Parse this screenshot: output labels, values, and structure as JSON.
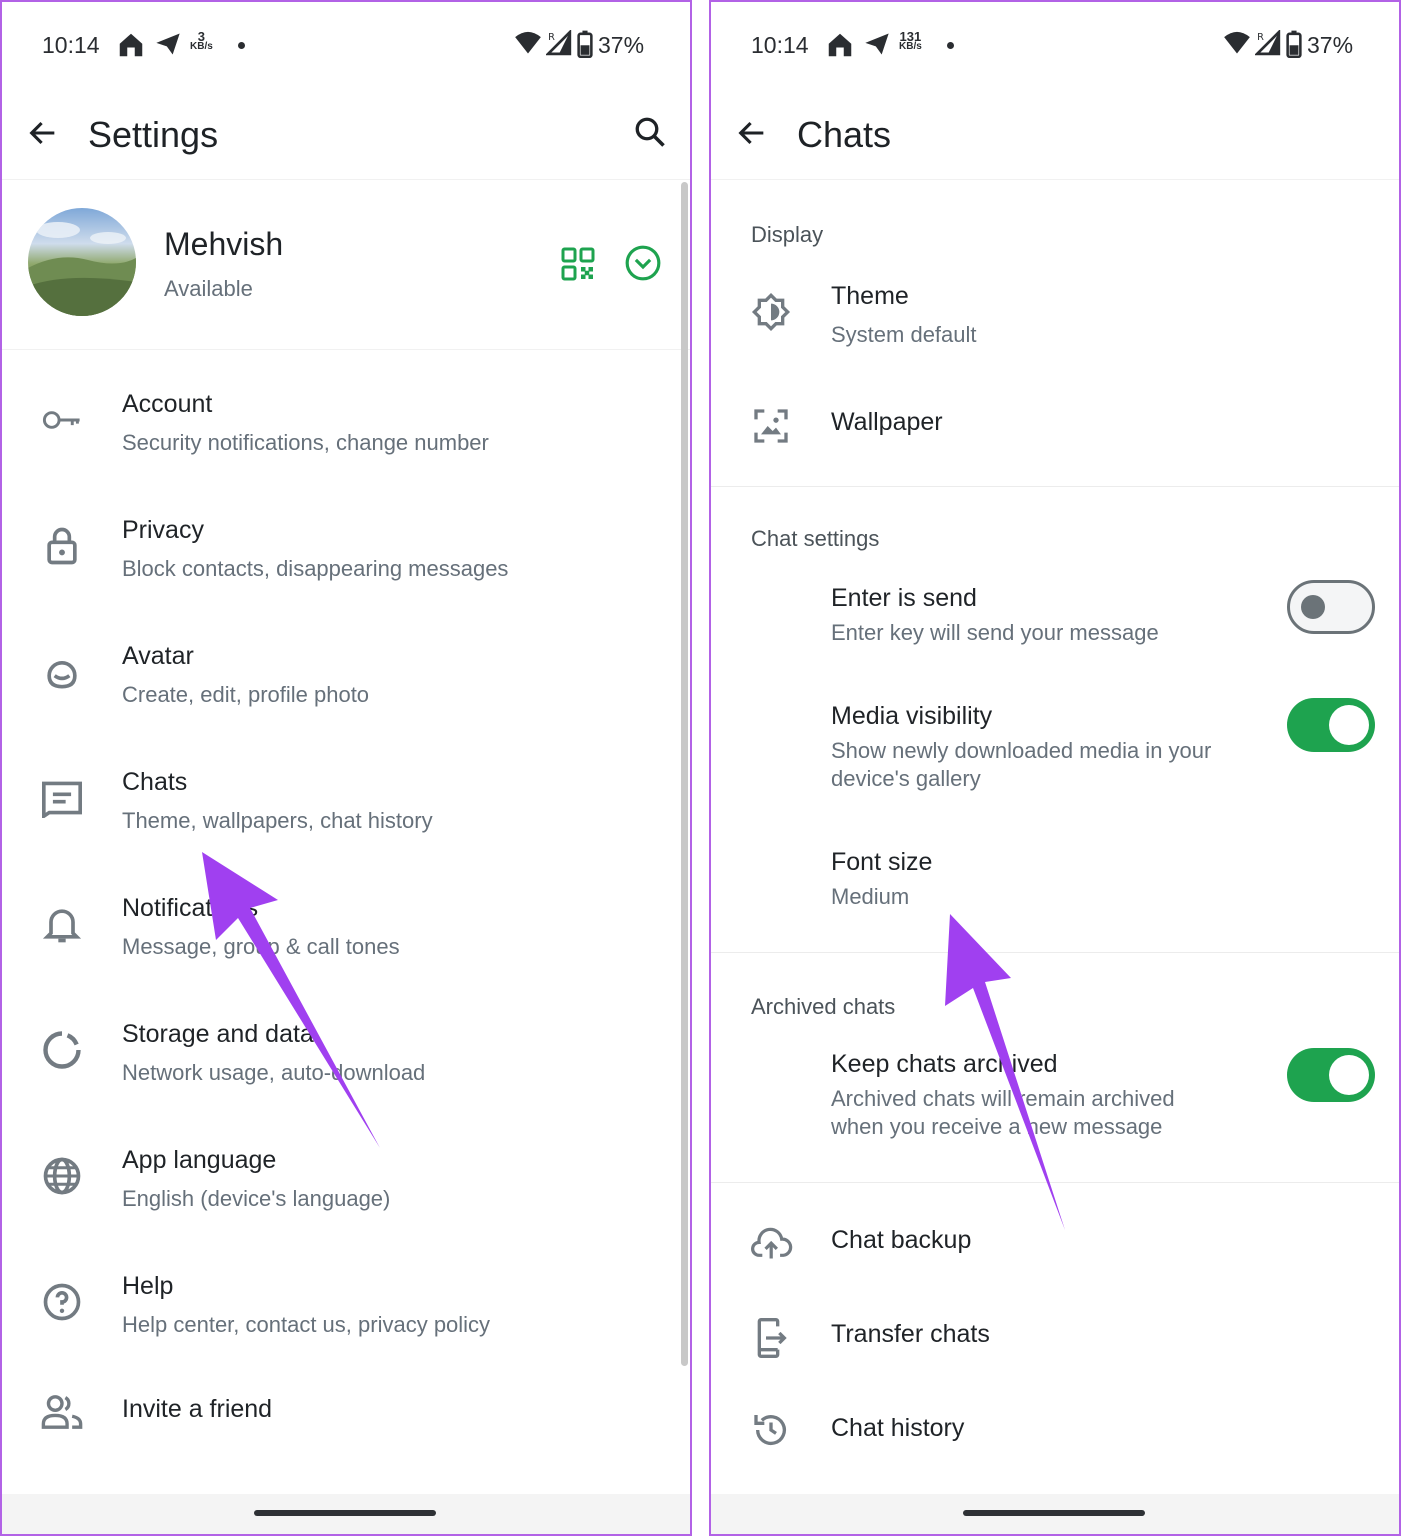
{
  "colors": {
    "accent": "#1ea34f",
    "arrow": "#a040f0",
    "border": "#b262e6"
  },
  "left": {
    "status": {
      "time": "10:14",
      "speed_value": "3",
      "speed_unit": "KB/s",
      "battery": "37%"
    },
    "appbar": {
      "title": "Settings",
      "back_icon": "arrow-back-icon",
      "search_icon": "search-icon"
    },
    "profile": {
      "name": "Mehvish",
      "status": "Available",
      "qr_icon": "qr-code-icon",
      "expand_icon": "chevron-down-circle-icon"
    },
    "items": [
      {
        "icon": "key-icon",
        "title": "Account",
        "subtitle": "Security notifications, change number"
      },
      {
        "icon": "lock-icon",
        "title": "Privacy",
        "subtitle": "Block contacts, disappearing messages"
      },
      {
        "icon": "avatar-face-icon",
        "title": "Avatar",
        "subtitle": "Create, edit, profile photo"
      },
      {
        "icon": "chat-list-icon",
        "title": "Chats",
        "subtitle": "Theme, wallpapers, chat history"
      },
      {
        "icon": "bell-icon",
        "title": "Notifications",
        "subtitle": "Message, group & call tones"
      },
      {
        "icon": "storage-circle-icon",
        "title": "Storage and data",
        "subtitle": "Network usage, auto-download"
      },
      {
        "icon": "globe-icon",
        "title": "App language",
        "subtitle": "English (device's language)"
      },
      {
        "icon": "help-circle-icon",
        "title": "Help",
        "subtitle": "Help center, contact us, privacy policy"
      },
      {
        "icon": "people-icon",
        "title": "Invite a friend",
        "subtitle": ""
      }
    ]
  },
  "right": {
    "status": {
      "time": "10:14",
      "speed_value": "131",
      "speed_unit": "KB/s",
      "battery": "37%"
    },
    "appbar": {
      "title": "Chats",
      "back_icon": "arrow-back-icon"
    },
    "display": {
      "heading": "Display",
      "theme": {
        "title": "Theme",
        "subtitle": "System default"
      },
      "wallpaper": {
        "title": "Wallpaper"
      }
    },
    "chat_settings": {
      "heading": "Chat settings",
      "enter_is_send": {
        "title": "Enter is send",
        "subtitle": "Enter key will send your message",
        "enabled": false
      },
      "media_visibility": {
        "title": "Media visibility",
        "subtitle_line1": "Show newly downloaded media in your",
        "subtitle_line2": "device's gallery",
        "enabled": true
      },
      "font_size": {
        "title": "Font size",
        "value": "Medium"
      }
    },
    "archived": {
      "heading": "Archived chats",
      "keep_archived": {
        "title": "Keep chats archived",
        "subtitle_line1": "Archived chats will remain archived",
        "subtitle_line2": "when you receive a new message",
        "enabled": true
      }
    },
    "more": [
      {
        "icon": "cloud-upload-icon",
        "title": "Chat backup"
      },
      {
        "icon": "phone-transfer-icon",
        "title": "Transfer chats"
      },
      {
        "icon": "history-icon",
        "title": "Chat history"
      }
    ]
  }
}
